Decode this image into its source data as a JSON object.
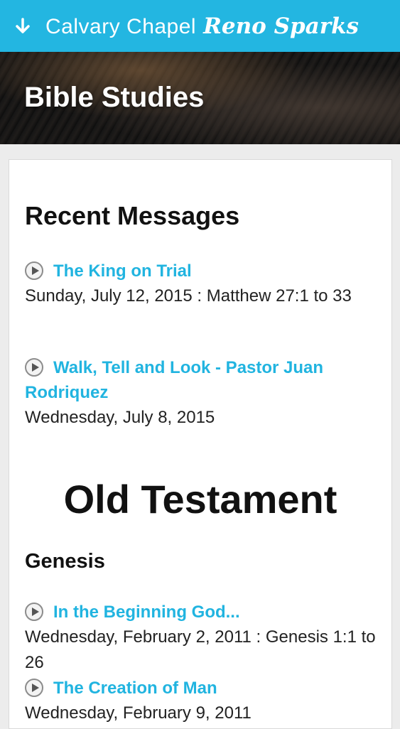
{
  "header": {
    "brand_main": "Calvary Chapel",
    "brand_script": "Reno Sparks",
    "menu_icon": "arrow-down-icon",
    "accent_color": "#23b6e1"
  },
  "hero": {
    "title": "Bible Studies"
  },
  "recent": {
    "heading": "Recent Messages",
    "items": [
      {
        "title": "The King on Trial",
        "meta": "Sunday, July 12, 2015 : Matthew 27:1 to 33"
      },
      {
        "title": "Walk, Tell and Look - Pastor Juan Rodriquez",
        "meta": "Wednesday, July 8, 2015"
      }
    ]
  },
  "old_testament": {
    "heading": "Old Testament",
    "book": "Genesis",
    "items": [
      {
        "title": "In the Beginning God...",
        "meta": "Wednesday, February 2, 2011 : Genesis 1:1 to 26"
      },
      {
        "title": "The Creation of Man",
        "meta": "Wednesday, February 9, 2011"
      }
    ]
  }
}
